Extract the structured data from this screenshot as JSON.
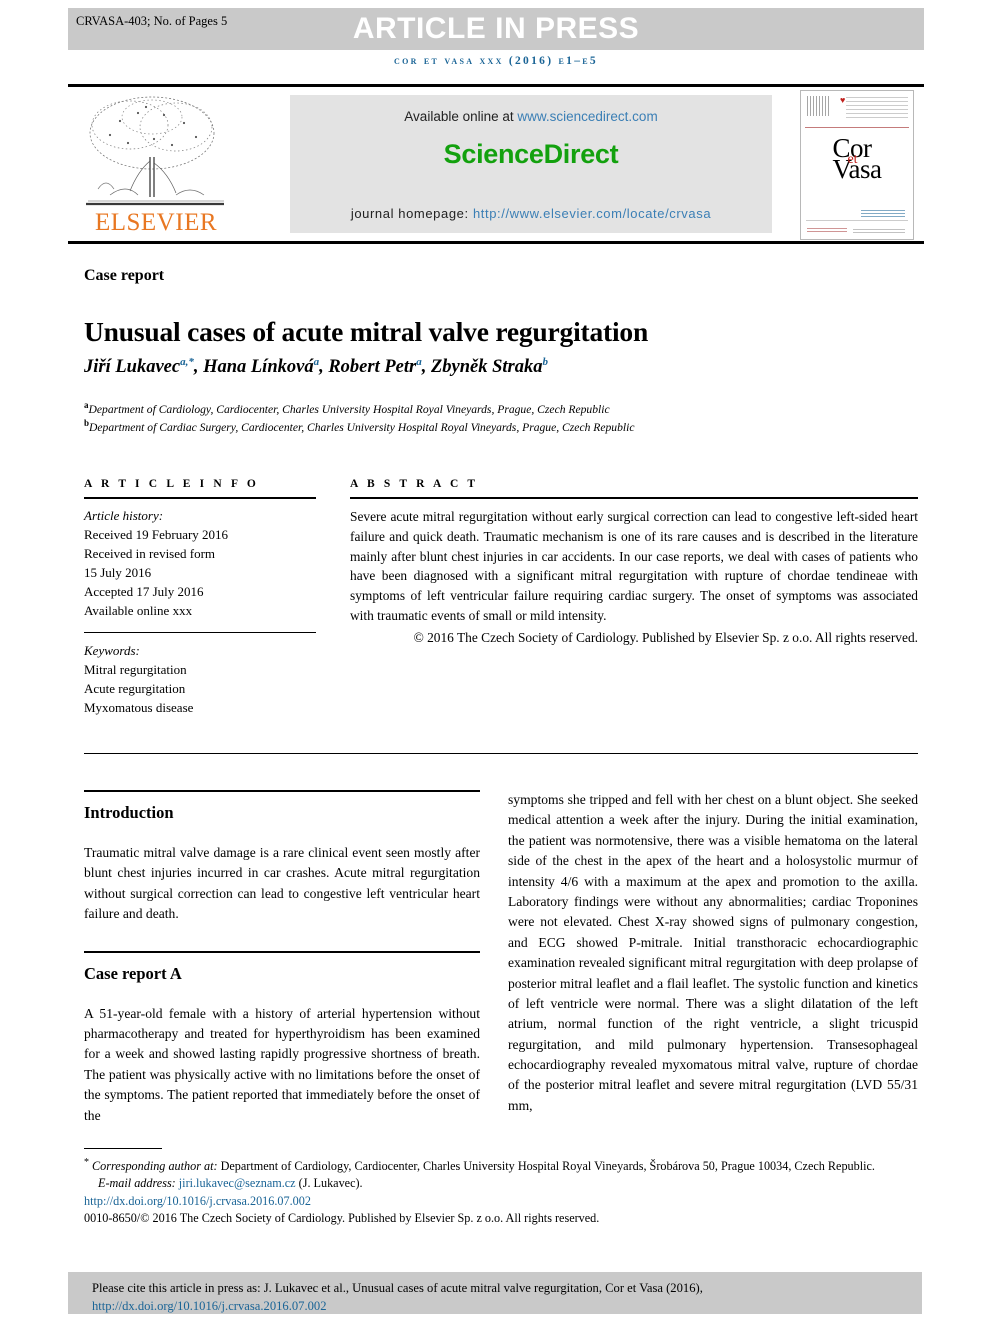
{
  "header": {
    "article_code": "CRVASA-403; No. of Pages 5",
    "press_banner": "ARTICLE IN PRESS",
    "journal_line": "cor et vasa xxx (2016) e1–e5"
  },
  "masthead": {
    "publisher": "ELSEVIER",
    "available_prefix": "Available online at ",
    "available_link": "www.sciencedirect.com",
    "brand": "ScienceDirect",
    "homepage_prefix": "journal homepage: ",
    "homepage_link": "http://www.elsevier.com/locate/crvasa",
    "cover_title_cor": "Cor",
    "cover_title_et": "et",
    "cover_title_vasa": "Vasa"
  },
  "article": {
    "kind": "Case report",
    "title": "Unusual cases of acute mitral valve regurgitation",
    "authors_html": "Jiří Lukavec<sup>a,*</sup>, Hana Línková<sup>a</sup>, Robert Petr<sup>a</sup>, Zbyněk Straka<sup>b</sup>",
    "affiliation_a": "Department of Cardiology, Cardiocenter, Charles University Hospital Royal Vineyards, Prague, Czech Republic",
    "affiliation_b": "Department of Cardiac Surgery, Cardiocenter, Charles University Hospital Royal Vineyards, Prague, Czech Republic"
  },
  "info": {
    "label": "A R T I C L E   I N F O",
    "history_label": "Article history:",
    "history": [
      "Received 19 February 2016",
      "Received in revised form",
      "15 July 2016",
      "Accepted 17 July 2016",
      "Available online xxx"
    ],
    "keywords_label": "Keywords:",
    "keywords": [
      "Mitral regurgitation",
      "Acute regurgitation",
      "Myxomatous disease"
    ]
  },
  "abstract": {
    "label": "A B S T R A C T",
    "body": "Severe acute mitral regurgitation without early surgical correction can lead to congestive left-sided heart failure and quick death. Traumatic mechanism is one of its rare causes and is described in the literature mainly after blunt chest injuries in car accidents. In our case reports, we deal with cases of patients who have been diagnosed with a significant mitral regurgitation with rupture of chordae tendineae with symptoms of left ventricular failure requiring cardiac surgery. The onset of symptoms was associated with traumatic events of small or mild intensity.",
    "copyright": "© 2016 The Czech Society of Cardiology. Published by Elsevier Sp. z o.o. All rights reserved."
  },
  "body": {
    "introduction_heading": "Introduction",
    "introduction_text": "Traumatic mitral valve damage is a rare clinical event seen mostly after blunt chest injuries incurred in car crashes. Acute mitral regurgitation without surgical correction can lead to congestive left ventricular heart failure and death.",
    "case_a_heading": "Case report A",
    "case_a_text": "A 51-year-old female with a history of arterial hypertension without pharmacotherapy and treated for hyperthyroidism has been examined for a week and showed lasting rapidly progressive shortness of breath. The patient was physically active with no limitations before the onset of the symptoms. The patient reported that immediately before the onset of the",
    "right_column_text": "symptoms she tripped and fell with her chest on a blunt object. She seeked medical attention a week after the injury. During the initial examination, the patient was normotensive, there was a visible hematoma on the lateral side of the chest in the apex of the heart and a holosystolic murmur of intensity 4/6 with a maximum at the apex and promotion to the axilla. Laboratory findings were without any abnormalities; cardiac Troponines were not elevated. Chest X-ray showed signs of pulmonary congestion, and ECG showed P-mitrale. Initial transthoracic echocardiographic examination revealed significant mitral regurgitation with deep prolapse of posterior mitral leaflet and a flail leaflet. The systolic function and kinetics of left ventricle were normal. There was a slight dilatation of the left atrium, normal function of the right ventricle, a slight tricuspid regurgitation, and mild pulmonary hypertension. Transesophageal echocardiography revealed myxomatous mitral valve, rupture of chordae of the posterior mitral leaflet and severe mitral regurgitation (LVD 55/31 mm,"
  },
  "footnotes": {
    "corresponding_label": "Corresponding author at:",
    "corresponding_text": " Department of Cardiology, Cardiocenter, Charles University Hospital Royal Vineyards, Šrobárova 50, Prague 10034, Czech Republic.",
    "email_label": "E-mail address: ",
    "email": "jiri.lukavec@seznam.cz",
    "email_suffix": " (J. Lukavec).",
    "doi": "http://dx.doi.org/10.1016/j.crvasa.2016.07.002",
    "issn_line": "0010-8650/© 2016 The Czech Society of Cardiology. Published by Elsevier Sp. z o.o. All rights reserved."
  },
  "citation": {
    "text": "Please cite this article in press as: J. Lukavec et al., Unusual cases of acute mitral valve regurgitation, Cor et Vasa (2016), ",
    "link": "http://dx.doi.org/10.1016/j.crvasa.2016.07.002"
  },
  "colors": {
    "band_gray": "#c9c9c9",
    "link_blue": "#1a6496",
    "sciencedirect_green": "#13a10e",
    "elsevier_orange": "#e87722",
    "cover_red": "#c0201c"
  }
}
